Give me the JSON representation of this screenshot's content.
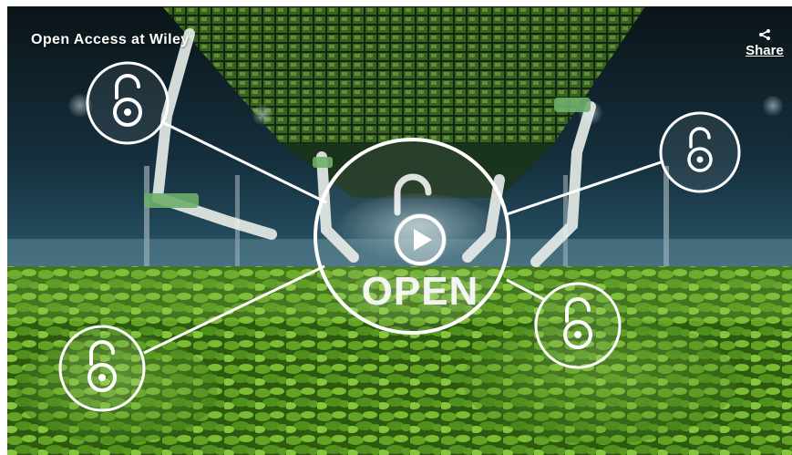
{
  "video": {
    "title": "Open Access at Wiley",
    "share_label": "Share",
    "center_text": "OPEN",
    "play_label": "Play video",
    "icons": {
      "share": "share-icon",
      "play": "play-icon",
      "unlocked": "open-lock-icon"
    }
  },
  "colors": {
    "overlay_line": "#ffffff",
    "foliage": "#4f8a1f",
    "sky": "#0f2a38",
    "robot_arm": "#e6ece8",
    "robot_green": "#7ab87a"
  }
}
